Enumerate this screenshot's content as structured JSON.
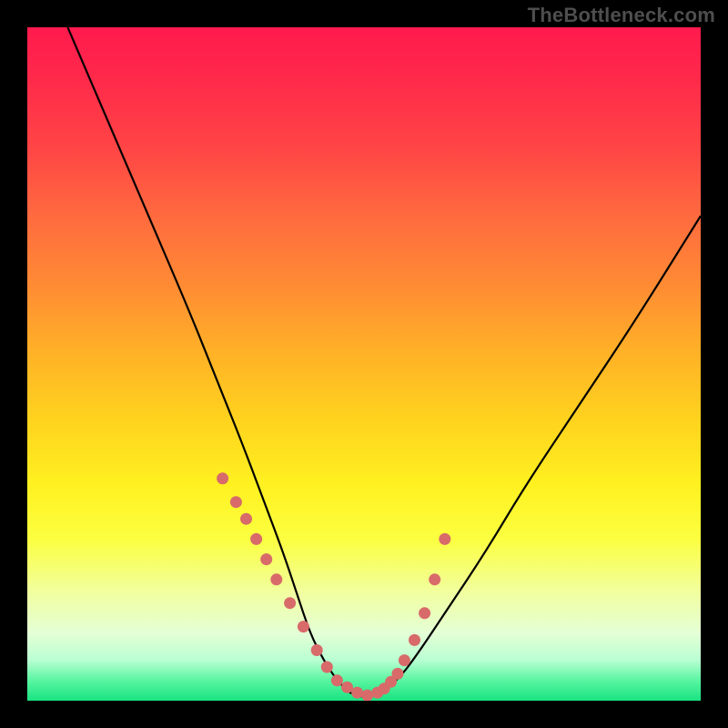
{
  "watermark": "TheBottleneck.com",
  "chart_data": {
    "type": "line",
    "title": "",
    "xlabel": "",
    "ylabel": "",
    "xlim": [
      0,
      100
    ],
    "ylim": [
      0,
      100
    ],
    "grid": false,
    "series": [
      {
        "name": "bottleneck-curve",
        "x": [
          6,
          12,
          18,
          24,
          28,
          32,
          35,
          38,
          40,
          42,
          44,
          46,
          48,
          50,
          52,
          55,
          58,
          62,
          68,
          74,
          82,
          90,
          100
        ],
        "y": [
          100,
          86,
          72,
          58,
          48,
          38,
          30,
          22,
          16,
          10,
          6,
          3,
          1,
          0.5,
          1,
          3,
          7,
          13,
          22,
          32,
          44,
          56,
          72
        ]
      }
    ],
    "markers": {
      "name": "sampled-points",
      "color": "#d86a6a",
      "size": 9,
      "x": [
        29,
        31,
        32.5,
        34,
        35.5,
        37,
        39,
        41,
        43,
        44.5,
        46,
        47.5,
        49,
        50.5,
        52,
        53,
        54,
        55,
        56,
        57.5,
        59,
        60.5,
        62
      ],
      "y": [
        33,
        29.5,
        27,
        24,
        21,
        18,
        14.5,
        11,
        7.5,
        5,
        3,
        2,
        1.2,
        0.8,
        1.2,
        1.8,
        2.8,
        4,
        6,
        9,
        13,
        18,
        24
      ]
    },
    "background_gradient": {
      "top": "#ff1a4d",
      "mid_upper": "#ff8a34",
      "mid": "#fff120",
      "mid_lower": "#e4ffd6",
      "bottom": "#19e382"
    }
  }
}
